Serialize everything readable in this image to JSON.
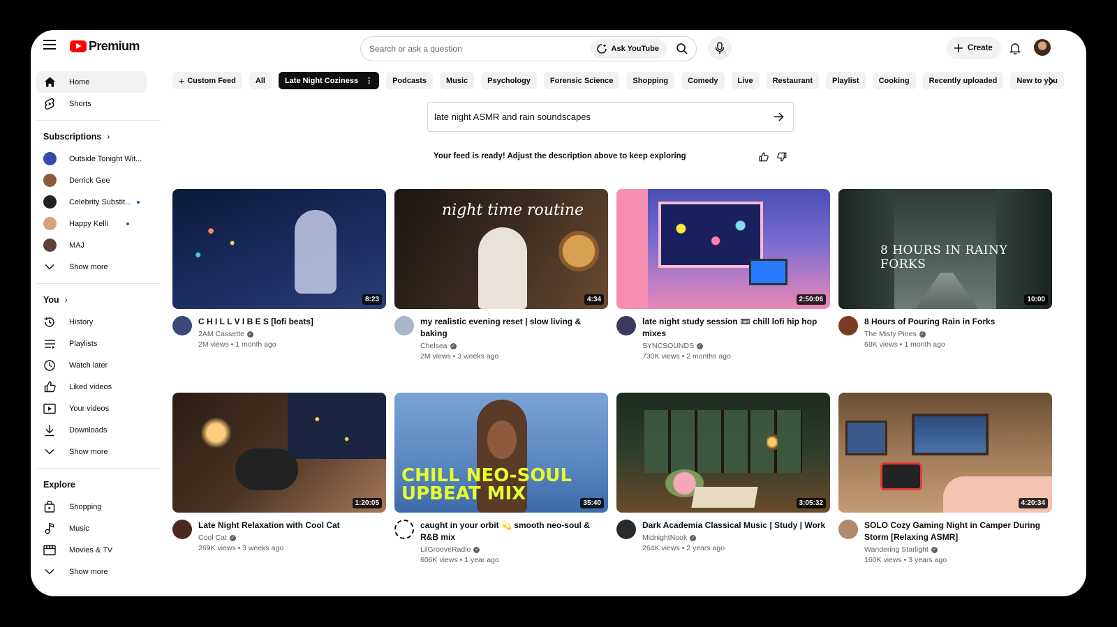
{
  "header": {
    "logo_text": "Premium",
    "search_placeholder": "Search or ask a question",
    "ask_label": "Ask YouTube",
    "create_label": "Create"
  },
  "sidebar": {
    "top": [
      {
        "label": "Home",
        "icon": "home-icon"
      },
      {
        "label": "Shorts",
        "icon": "shorts-icon"
      }
    ],
    "subscriptions_title": "Subscriptions",
    "subscriptions": [
      {
        "label": "Outside Tonight Wit...",
        "color": "#3949ab",
        "dot": false
      },
      {
        "label": "Derrick Gee",
        "color": "#8d5a3b",
        "dot": false
      },
      {
        "label": "Celebrity Substit...",
        "color": "#222222",
        "dot": true
      },
      {
        "label": "Happy Kelli",
        "color": "#d9a27a",
        "dot": true
      },
      {
        "label": "MAJ",
        "color": "#5d4037",
        "dot": false
      }
    ],
    "show_more": "Show more",
    "you_title": "You",
    "you_items": [
      {
        "label": "History",
        "icon": "history-icon"
      },
      {
        "label": "Playlists",
        "icon": "playlists-icon"
      },
      {
        "label": "Watch later",
        "icon": "watch-later-icon"
      },
      {
        "label": "Liked videos",
        "icon": "liked-videos-icon"
      },
      {
        "label": "Your videos",
        "icon": "your-videos-icon"
      },
      {
        "label": "Downloads",
        "icon": "downloads-icon"
      }
    ],
    "explore_title": "Explore",
    "explore_items": [
      {
        "label": "Shopping",
        "icon": "shopping-icon"
      },
      {
        "label": "Music",
        "icon": "music-icon"
      },
      {
        "label": "Movies & TV",
        "icon": "movies-icon"
      }
    ]
  },
  "chips": [
    "Custom Feed",
    "All",
    "Late Night Coziness",
    "Podcasts",
    "Music",
    "Psychology",
    "Forensic Science",
    "Shopping",
    "Comedy",
    "Live",
    "Restaurant",
    "Playlist",
    "Cooking",
    "Recently uploaded",
    "New to you"
  ],
  "selected_chip": "Late Night Coziness",
  "prompt": {
    "value": "late night ASMR and rain soundscapes",
    "feed_message": "Your feed is ready! Adjust the description above to keep exploring"
  },
  "videos": [
    {
      "title": "C H I L L  V I B E S [lofi beats]",
      "channel": "2AM Cassette",
      "verified": true,
      "stats": "2M views • 1 month ago",
      "duration": "8:23",
      "thumb_colors": [
        "#0b1a3a",
        "#2a3f75"
      ],
      "avatar_color": "#3b4a7a"
    },
    {
      "title": "my realistic evening reset | slow living & baking",
      "channel": "Chelsea",
      "verified": true,
      "stats": "2M views • 3 weeks ago",
      "duration": "4:34",
      "thumb_colors": [
        "#1c1612",
        "#6b4a30"
      ],
      "avatar_color": "#a7b7c9",
      "overlay": "night time routine"
    },
    {
      "title": "late night study session 📼 chill lofi hip hop mixes",
      "channel": "SYNCSOUNDS",
      "verified": true,
      "stats": "730K views • 2 months ago",
      "duration": "2:50:06",
      "thumb_colors": [
        "#e989b8",
        "#4a4fb2"
      ],
      "avatar_color": "#3a3a5a"
    },
    {
      "title": "8 Hours of Pouring Rain in Forks",
      "channel": "The Misty Pines",
      "verified": true,
      "stats": "68K views • 1 month ago",
      "duration": "10:00",
      "thumb_colors": [
        "#2e3a33",
        "#6d7c77"
      ],
      "avatar_color": "#7a3b22",
      "overlay": "8 HOURS IN RAINY FORKS"
    },
    {
      "title": "Late Night Relaxation with Cool Cat",
      "channel": "Cool Cat",
      "verified": true,
      "stats": "269K views • 3 weeks ago",
      "duration": "1:20:05",
      "thumb_colors": [
        "#2a1c14",
        "#a6775a"
      ],
      "avatar_color": "#4a2a20"
    },
    {
      "title": "caught in your orbit 💫 smooth neo-soul & R&B mix",
      "channel": "LilGrooveRadio",
      "verified": true,
      "stats": "606K views • 1 year ago",
      "duration": "35:40",
      "thumb_colors": [
        "#7aa4d6",
        "#3d6aa8"
      ],
      "avatar_color": "#ffffff",
      "overlay": "CHILL NEO-SOUL UPBEAT MIX"
    },
    {
      "title": "Dark Academia Classical Music | Study | Work",
      "channel": "MidnightNook",
      "verified": true,
      "stats": "264K views • 2 years ago",
      "duration": "3:05:32",
      "thumb_colors": [
        "#1d2a20",
        "#6a4a2a"
      ],
      "avatar_color": "#2a2a2a"
    },
    {
      "title": "SOLO Cozy Gaming Night in Camper During Storm [Relaxing ASMR]",
      "channel": "Wandering Starlight",
      "verified": true,
      "stats": "160K views • 3 years ago",
      "duration": "4:20:34",
      "thumb_colors": [
        "#3a5a8a",
        "#c59b74"
      ],
      "avatar_color": "#b08a6a"
    }
  ]
}
